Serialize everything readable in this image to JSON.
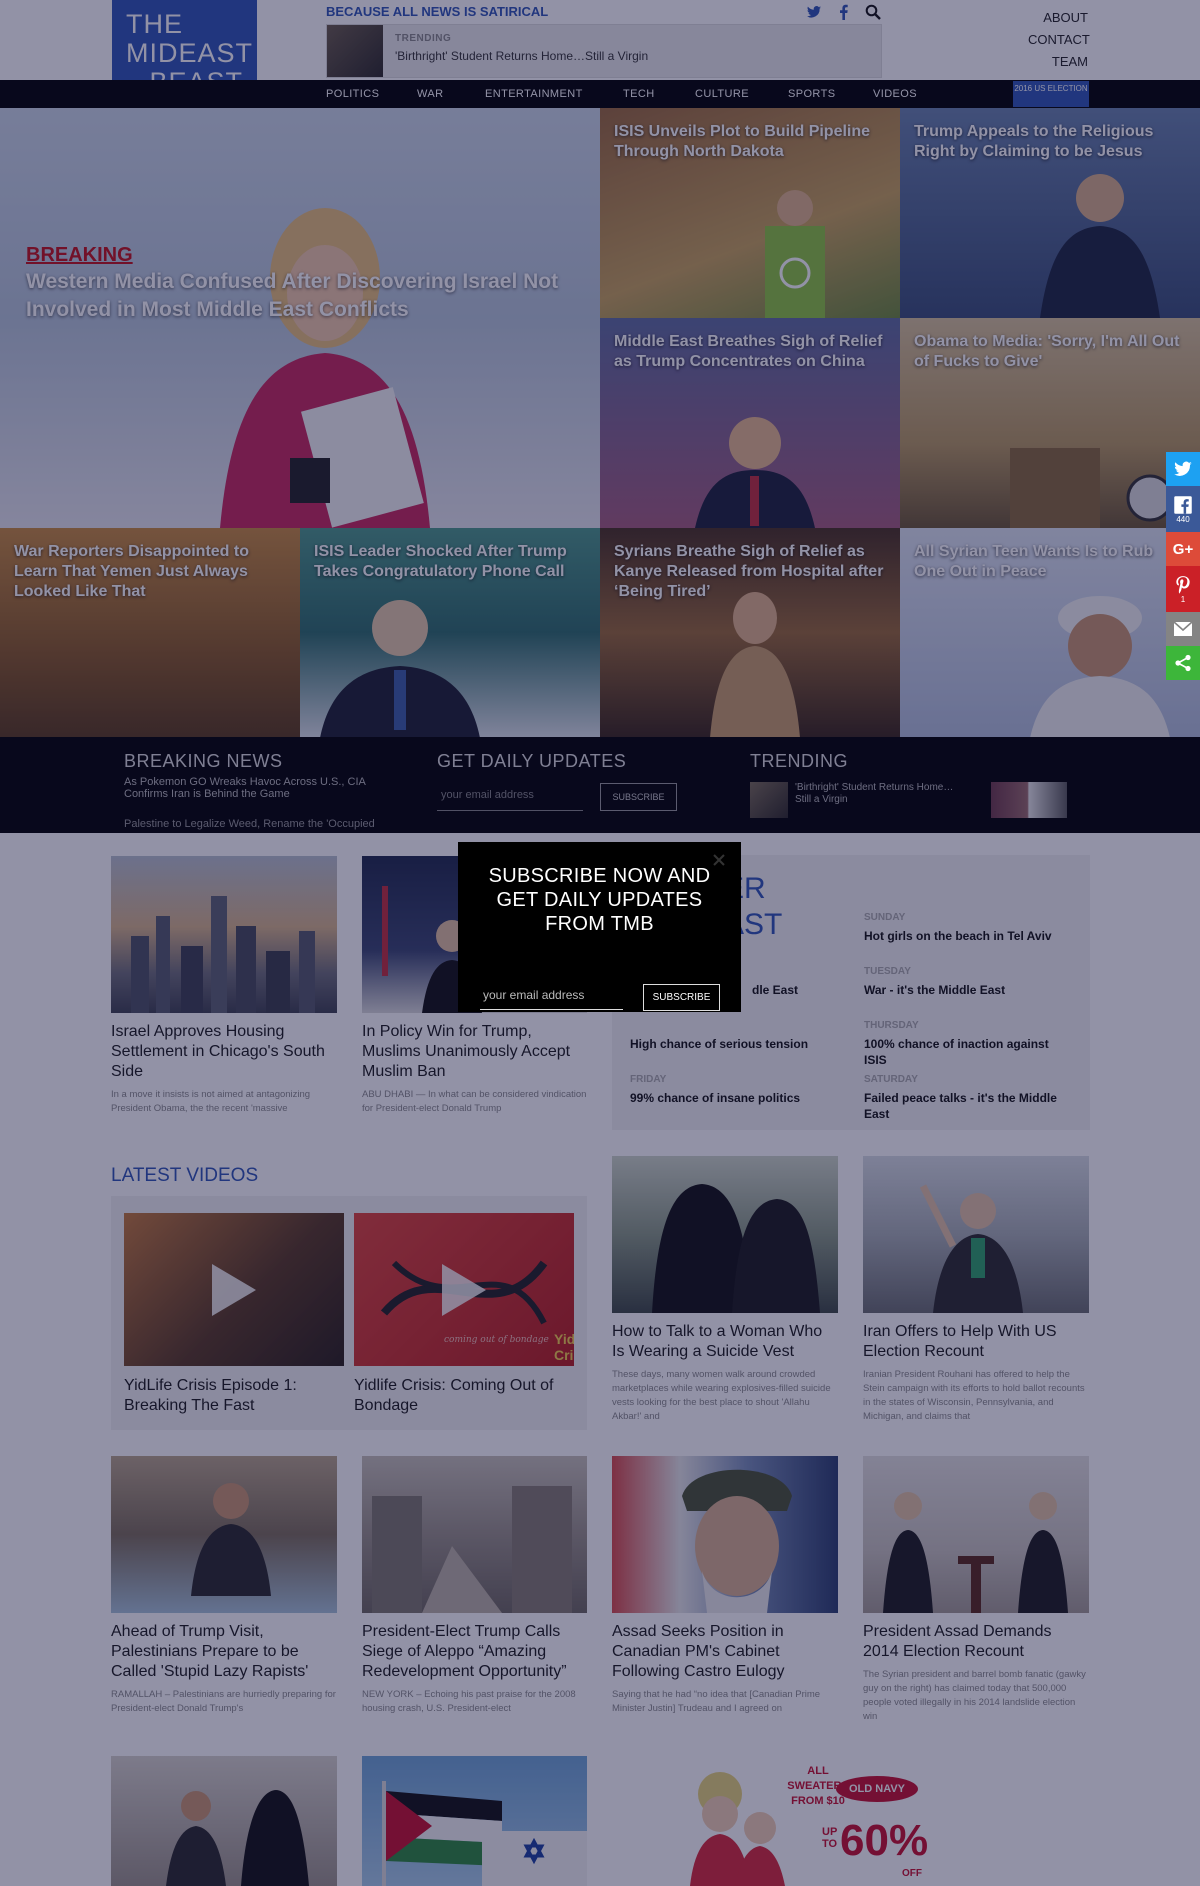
{
  "header": {
    "logo_lines": [
      "THE",
      "MIDEAST",
      "BEAST"
    ],
    "tagline": "BECAUSE ALL NEWS IS SATIRICAL",
    "trending_label": "TRENDING",
    "trending_headline": "'Birthright' Student Returns Home…Still a Virgin",
    "top_links": [
      "ABOUT",
      "CONTACT",
      "TEAM"
    ],
    "icons": [
      "twitter-icon",
      "facebook-icon",
      "search-icon"
    ]
  },
  "nav": {
    "items": [
      "POLITICS",
      "WAR",
      "ENTERTAINMENT",
      "TECH",
      "CULTURE",
      "SPORTS",
      "VIDEOS"
    ],
    "election_badge": "2016 US ELECTION"
  },
  "hero": {
    "label": "BREAKING",
    "headline": "Western Media Confused After Discovering Israel Not Involved in Most Middle East Conflicts"
  },
  "tiles": [
    "ISIS Unveils Plot to Build Pipeline Through North Dakota",
    "Trump Appeals to the Religious Right by Claiming to be Jesus",
    "Middle East Breathes Sigh of Relief as Trump Concentrates on China",
    "Obama to Media: 'Sorry, I'm All Out of Fucks to Give'",
    "War Reporters Disappointed to Learn That Yemen Just Always Looked Like That",
    "ISIS Leader Shocked After Trump Takes Congratulatory Phone Call",
    "Syrians Breathe Sigh of Relief as Kanye Released from Hospital after ‘Being Tired’",
    "All Syrian Teen Wants Is to Rub One Out in Peace"
  ],
  "strip": {
    "breaking_title": "BREAKING NEWS",
    "breaking_items": [
      "As Pokemon GO Wreaks Havoc Across U.S., CIA Confirms Iran is Behind the Game",
      "Palestine to Legalize Weed, Rename the 'Occupied"
    ],
    "updates_title": "GET DAILY UPDATES",
    "email_placeholder": "your email address",
    "subscribe_label": "SUBSCRIBE",
    "trending_title": "TRENDING",
    "trending_item": "'Birthright' Student Returns Home… Still a Virgin"
  },
  "cards_row1": [
    {
      "title": "Israel Approves Housing Settlement in Chicago's South Side",
      "excerpt": "In a move it insists is not aimed at antagonizing President Obama, the the recent 'massive"
    },
    {
      "title": "In Policy Win for Trump, Muslims Unanimously Accept Muslim Ban",
      "excerpt": "ABU DHABI — In what can be considered vindication for President-elect Donald Trump"
    }
  ],
  "forecast": {
    "title_fragments": [
      "ER",
      "AST"
    ],
    "days": [
      {
        "day": "SUNDAY",
        "value": "Hot girls on the beach in Tel Aviv"
      },
      {
        "day": "",
        "value": "dle East"
      },
      {
        "day": "TUESDAY",
        "value": "War - it's the Middle East"
      },
      {
        "day": "",
        "value": "High chance of serious tension"
      },
      {
        "day": "THURSDAY",
        "value": "100% chance of inaction against ISIS"
      },
      {
        "day": "FRIDAY",
        "value": "99% chance of insane politics"
      },
      {
        "day": "SATURDAY",
        "value": "Failed peace talks - it's the Middle East"
      }
    ]
  },
  "videos": {
    "heading": "LATEST VIDEOS",
    "items": [
      "YidLife Crisis Episode 1: Breaking The Fast",
      "Yidlife Crisis: Coming Out of Bondage"
    ],
    "overlay_text": [
      "coming out of bondage",
      "Yid",
      "Cri"
    ]
  },
  "cards_row2": [
    {
      "title": "How to Talk to a Woman Who Is Wearing a Suicide Vest",
      "excerpt": "These days, many women walk around crowded marketplaces while wearing explosives-filled suicide vests looking for the best place to shout 'Allahu Akbar!' and"
    },
    {
      "title": "Iran Offers to Help With US Election Recount",
      "excerpt": "Iranian President Rouhani has offered to help the Stein campaign with its efforts to hold ballot recounts in the states of Wisconsin, Pennsylvania, and Michigan, and claims that"
    }
  ],
  "cards_row3": [
    {
      "title": "Ahead of Trump Visit, Palestinians Prepare to be Called 'Stupid Lazy Rapists'",
      "excerpt": "RAMALLAH – Palestinians are hurriedly preparing for President-elect Donald Trump's"
    },
    {
      "title": "President-Elect Trump Calls Siege of Aleppo “Amazing Redevelopment Opportunity”",
      "excerpt": "NEW YORK – Echoing his past praise for the 2008 housing crash, U.S. President-elect"
    },
    {
      "title": "Assad Seeks Position in Canadian PM's Cabinet Following Castro Eulogy",
      "excerpt": "Saying that he had “no idea that [Canadian Prime Minister Justin] Trudeau and I agreed on"
    },
    {
      "title": "President Assad Demands 2014 Election Recount",
      "excerpt": "The Syrian president and barrel bomb fanatic (gawky guy on the right) has claimed today that 500,000 people voted illegally in his 2014 landslide election win"
    }
  ],
  "modal": {
    "title": "SUBSCRIBE NOW AND GET DAILY UPDATES FROM TMB",
    "email_placeholder": "your email address",
    "subscribe_label": "SUBSCRIBE"
  },
  "share": {
    "facebook_count": "440",
    "pinterest_count": "1",
    "icons": [
      "twitter-icon",
      "facebook-icon",
      "google-plus-icon",
      "pinterest-icon",
      "email-icon",
      "more-share-icon"
    ]
  },
  "ad": {
    "lines": [
      "ALL",
      "SWEATERS",
      "FROM $10"
    ],
    "brand": "OLD NAVY",
    "up_to": "UP TO",
    "percent": "60%",
    "off": "OFF"
  },
  "colors": {
    "brand_blue": "#2f56b5",
    "breaking_red": "#c41219",
    "twitter": "#1da1f2",
    "facebook": "#3b5998",
    "google": "#dd4b39",
    "pinterest": "#cb2027",
    "email": "#848484",
    "more": "#3db63a"
  }
}
